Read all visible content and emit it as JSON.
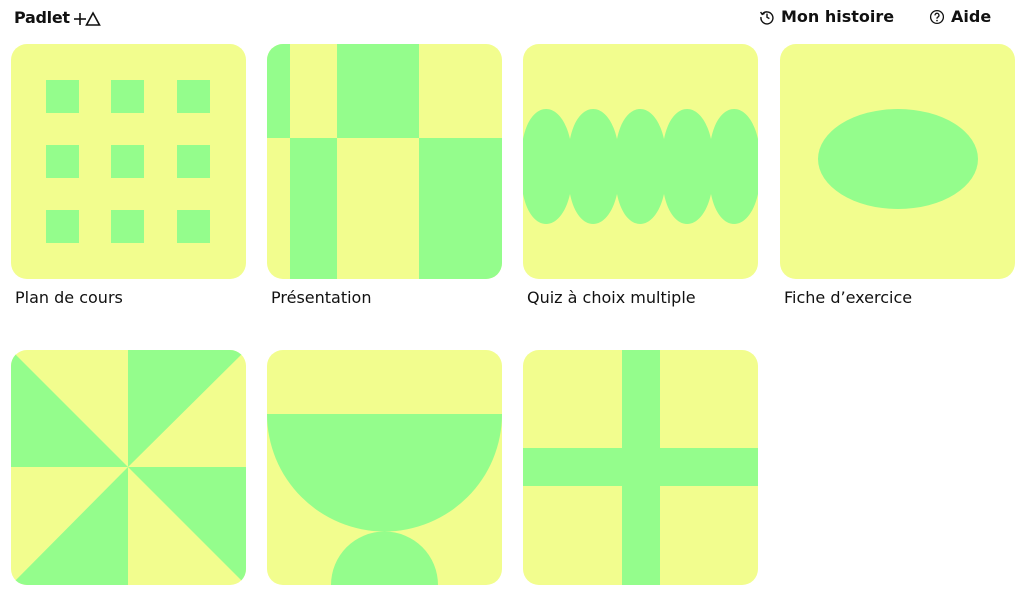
{
  "header": {
    "brand": "Padlet",
    "history_label": "Mon histoire",
    "help_label": "Aide",
    "icons": {
      "brand_logo": "plus-triangle-icon",
      "history": "history-clock-icon",
      "help": "help-circle-icon"
    }
  },
  "colors": {
    "background": "#ffffff",
    "tile_yellow": "#f2fd8e",
    "tile_green": "#94fd8c",
    "text": "#111111"
  },
  "templates": [
    {
      "label": "Plan de cours",
      "pattern": "grid-squares"
    },
    {
      "label": "Présentation",
      "pattern": "stripes-blocks"
    },
    {
      "label": "Quiz à choix multiple",
      "pattern": "wave-band"
    },
    {
      "label": "Fiche d’exercice",
      "pattern": "ellipse"
    },
    {
      "label": "",
      "pattern": "pinwheel"
    },
    {
      "label": "",
      "pattern": "chalice"
    },
    {
      "label": "",
      "pattern": "cross"
    }
  ]
}
